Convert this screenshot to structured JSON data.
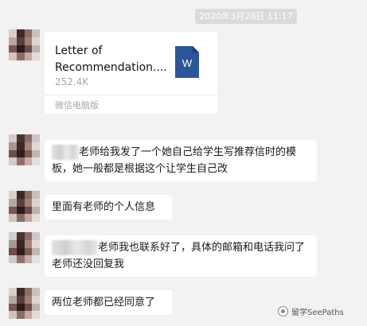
{
  "timestamp": "2020年3月28日 11:17",
  "file_message": {
    "file_name": "Letter of Recommendation....",
    "file_size": "252.4K",
    "source": "微信电脑版",
    "file_icon": "word-document-icon",
    "file_icon_letter": "W",
    "file_icon_color": "#2b579a"
  },
  "messages": [
    {
      "text": "老师给我发了一个她自己给学生写推荐信时的模板，她一般都是根据这个让学生自己改",
      "blurred_name": true
    },
    {
      "text": "里面有老师的个人信息",
      "blurred_name": false
    },
    {
      "text": "老师我也联系好了，具体的邮箱和电话我问了老师还没回复我",
      "blurred_name": true
    },
    {
      "text": "两位老师都已经同意了",
      "blurred_name": false
    }
  ],
  "watermark": {
    "text": "留学SeePaths",
    "icon": "wechat-official-account-icon"
  },
  "colors": {
    "background": "#f2f2f2",
    "bubble": "#ffffff",
    "timestamp_bg": "#dadada"
  }
}
